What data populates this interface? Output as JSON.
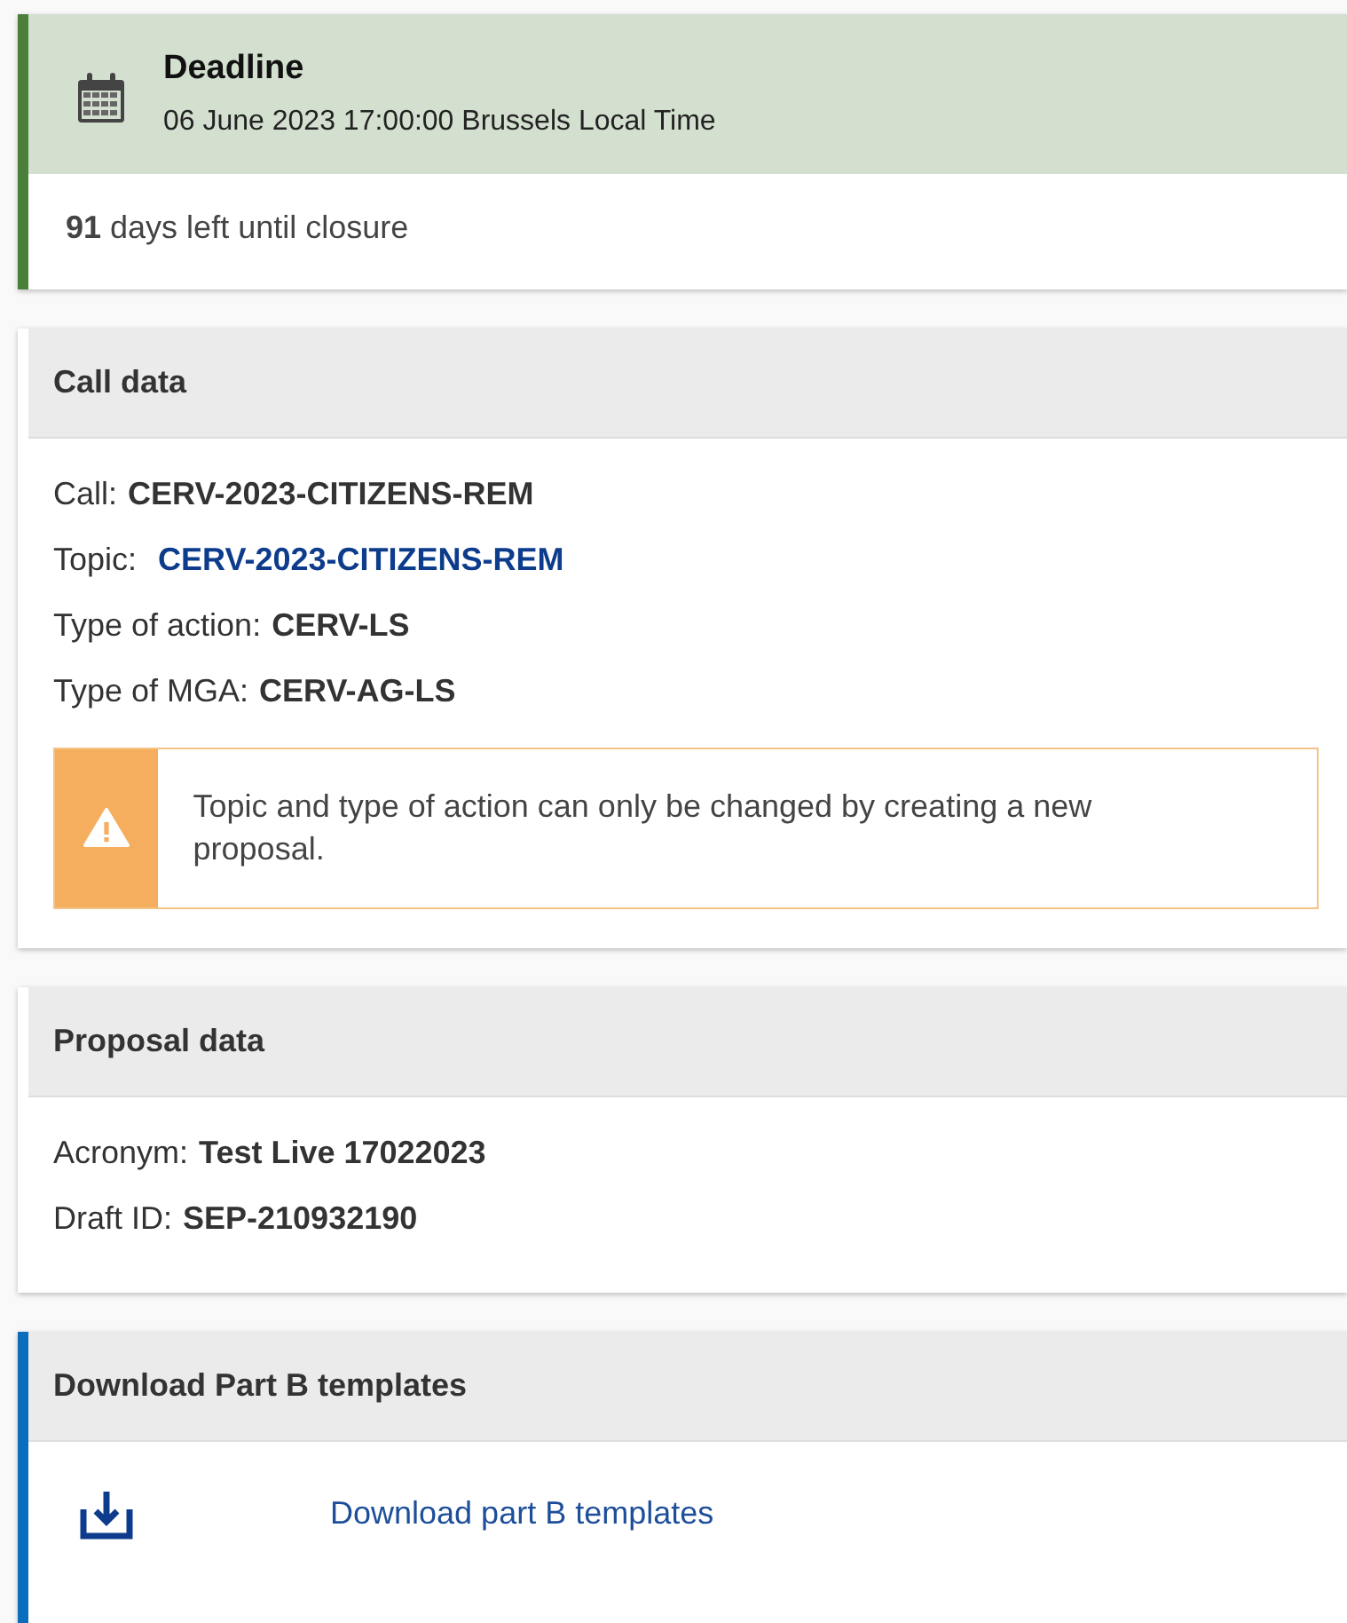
{
  "deadline": {
    "title": "Deadline",
    "date": "06 June 2023 17:00:00 Brussels Local Time",
    "remaining": "**91** days left until closure"
  },
  "sections": [
    {
      "title": "Call data",
      "highlighted": false,
      "fields": [
        {
          "label": "Call:",
          "value": "CERV-2023-CITIZENS-REM",
          "kind": "text"
        },
        {
          "label": "Topic:",
          "value": "CERV-2023-CITIZENS-REM",
          "kind": "link"
        },
        {
          "label": "Type of action:",
          "value": "CERV-LS",
          "kind": "text"
        },
        {
          "label": "Type of MGA:",
          "value": "CERV-AG-LS",
          "kind": "text"
        }
      ],
      "warning": "Topic and type of action can only be changed by creating a new proposal."
    },
    {
      "title": "Proposal data",
      "highlighted": false,
      "fields": [
        {
          "label": "Acronym:",
          "value": "Test Live 17022023",
          "kind": "text"
        },
        {
          "label": "Draft ID:",
          "value": "SEP-210932190",
          "kind": "text"
        }
      ]
    },
    {
      "title": "Download Part B templates",
      "highlighted": true,
      "download": "Download part B templates"
    }
  ]
}
